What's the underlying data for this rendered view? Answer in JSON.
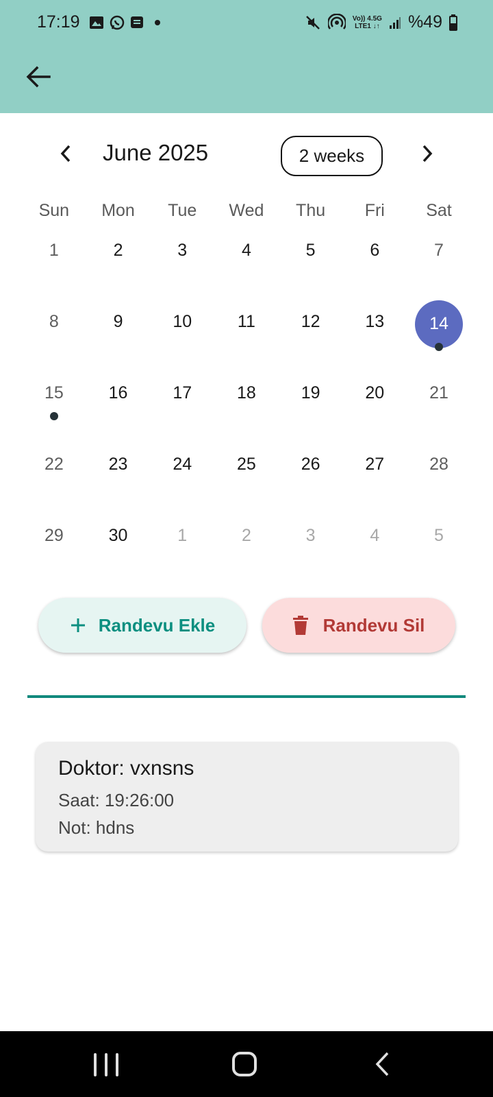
{
  "status_bar": {
    "time": "17:19",
    "battery": "%49",
    "network_top": "Vo)) 4.5G",
    "network_bottom": "LTE1 ↓↑",
    "left_icons": [
      "image-icon",
      "whatsapp-icon",
      "message-icon",
      "dot-icon"
    ],
    "right_icons": [
      "mute-icon",
      "hotspot-icon",
      "signal-icon",
      "battery-icon"
    ]
  },
  "app_bar": {
    "back_icon": "arrow-back-icon",
    "color": "#91cfc5"
  },
  "calendar": {
    "month_title": "June 2025",
    "format_button": "2 weeks",
    "days_of_week": [
      "Sun",
      "Mon",
      "Tue",
      "Wed",
      "Thu",
      "Fri",
      "Sat"
    ],
    "weeks": [
      [
        "1",
        "2",
        "3",
        "4",
        "5",
        "6",
        "7"
      ],
      [
        "8",
        "9",
        "10",
        "11",
        "12",
        "13",
        "14"
      ],
      [
        "15",
        "16",
        "17",
        "18",
        "19",
        "20",
        "21"
      ],
      [
        "22",
        "23",
        "24",
        "25",
        "26",
        "27",
        "28"
      ],
      [
        "29",
        "30",
        "1",
        "2",
        "3",
        "4",
        "5"
      ]
    ],
    "selected_day": "14",
    "event_days": [
      "14",
      "15"
    ],
    "selected_color": "#5c6bc0"
  },
  "actions": {
    "add_label": "Randevu Ekle",
    "delete_label": "Randevu Sil"
  },
  "appointment": {
    "doctor": "Doktor: vxnsns",
    "time": "Saat: 19:26:00",
    "note": "Not: hdns"
  }
}
